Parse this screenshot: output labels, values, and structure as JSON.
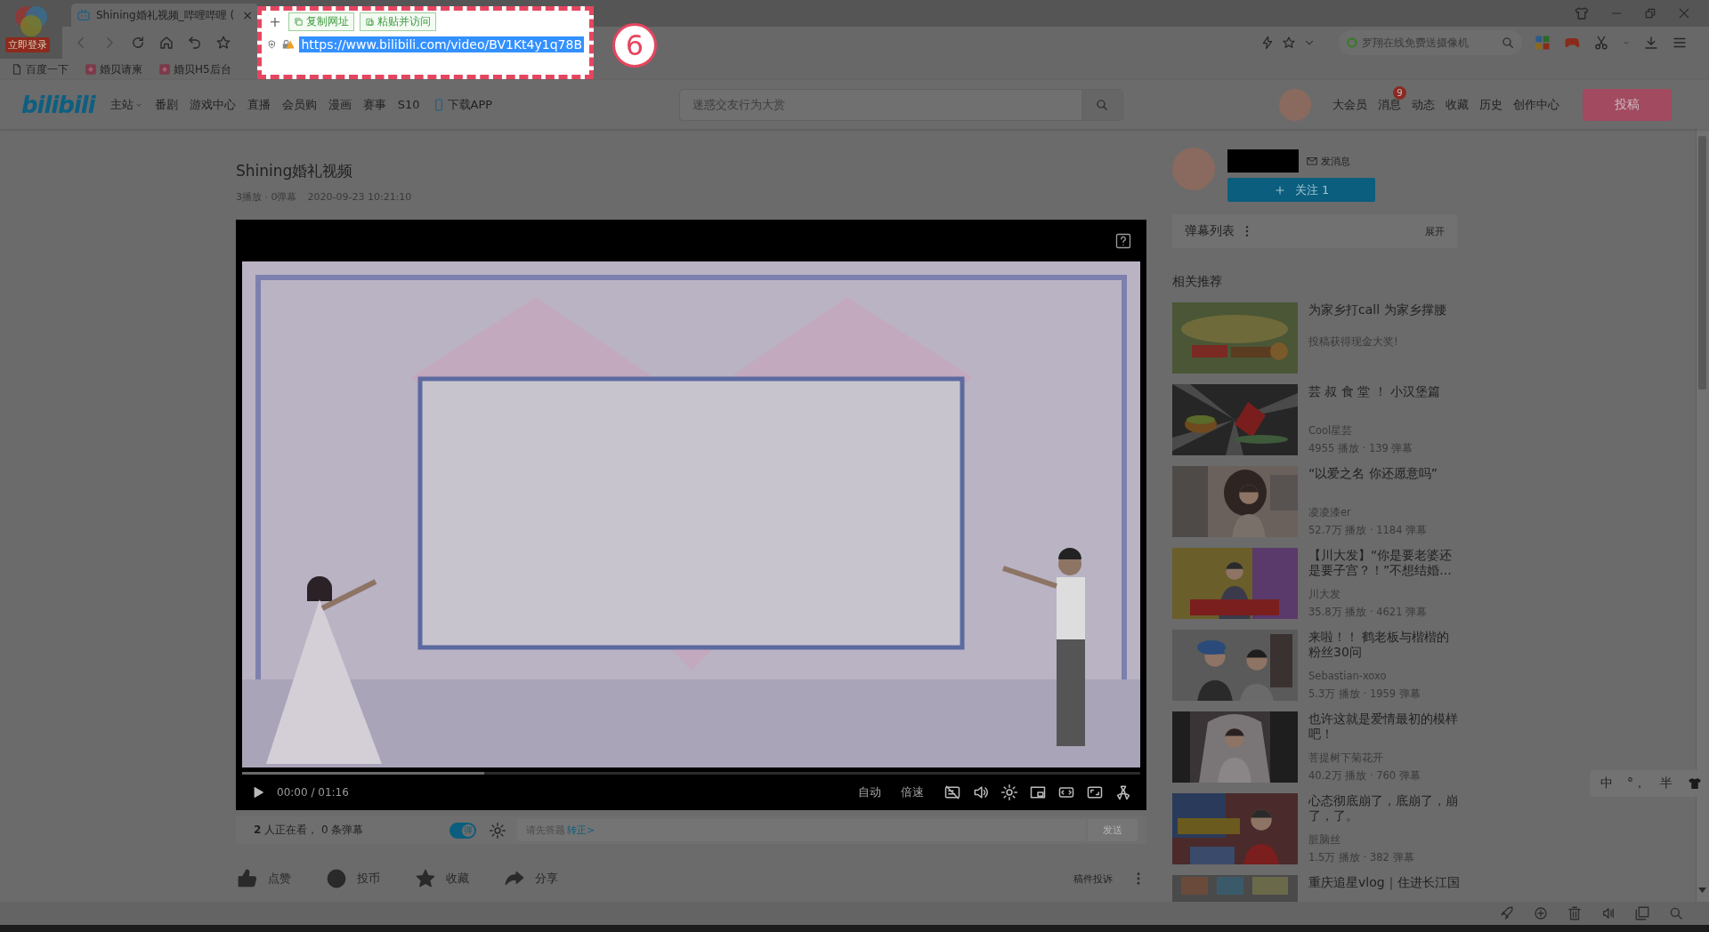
{
  "browser": {
    "login_badge": "立即登录",
    "tab": {
      "title": "Shining婚礼视频_哔哩哔哩 (",
      "close": "×"
    },
    "new_tab": "+",
    "address_popup": {
      "buttons": [
        "复制网址",
        "粘贴并访问"
      ],
      "url": "https://www.bilibili.com/video/BV1Kt4y1q78B",
      "url_selected": true
    },
    "callout": "6",
    "search": {
      "placeholder": "罗翔在线免费送摄像机"
    },
    "bookmarks": [
      {
        "kind": "page",
        "label": "百度一下"
      },
      {
        "kind": "site",
        "label": "婚贝请柬"
      },
      {
        "kind": "site",
        "label": "婚贝H5后台"
      }
    ]
  },
  "nav": {
    "logo": "bilibili",
    "items": [
      {
        "label": "主站",
        "dropdown": true
      },
      {
        "label": "番剧",
        "dropdown": false
      },
      {
        "label": "游戏中心",
        "dropdown": false
      },
      {
        "label": "直播",
        "dropdown": false
      },
      {
        "label": "会员购",
        "dropdown": false
      },
      {
        "label": "漫画",
        "dropdown": false
      },
      {
        "label": "赛事",
        "dropdown": false
      },
      {
        "label": "S10",
        "dropdown": false
      }
    ],
    "download": "下载APP",
    "search": {
      "placeholder": "迷惑交友行为大赏"
    },
    "links": [
      {
        "label": "大会员"
      },
      {
        "label": "消息",
        "badge": "9"
      },
      {
        "label": "动态"
      },
      {
        "label": "收藏"
      },
      {
        "label": "历史"
      },
      {
        "label": "创作中心"
      }
    ],
    "upload": "投稿"
  },
  "video": {
    "title": "Shining婚礼视频",
    "stats": "3播放 · 0弹幕",
    "date": "2020-09-23 10:21:10",
    "player": {
      "time": "00:00 / 01:16",
      "buffered": {
        "level": 0.27
      },
      "buttons": [
        "自动",
        "倍速"
      ]
    }
  },
  "danmaku_bar": {
    "viewers": "**2** 人正在看， 0 条弹幕",
    "toggle": {
      "label": "弹",
      "on": true
    },
    "input": {
      "placeholder": "请先答题",
      "link": "转正>"
    },
    "send": {
      "label": "发送",
      "disabled": true
    }
  },
  "actions": [
    {
      "kind": "like",
      "label": "点赞"
    },
    {
      "kind": "coin",
      "label": "投币"
    },
    {
      "kind": "favorite",
      "label": "收藏"
    },
    {
      "kind": "share",
      "label": "分享"
    }
  ],
  "report": "稿件投诉",
  "uploader": {
    "message": "发消息",
    "follow": "关注 1"
  },
  "danmaku_list": {
    "title": "弹幕列表",
    "expand": "展开"
  },
  "related": {
    "title": "相关推荐",
    "items": [
      {
        "kind": "ad",
        "title": "为家乡打call 为家乡撑腰",
        "note": "投稿获得现金大奖!"
      },
      {
        "kind": "video",
        "title": "芸 叔 食 堂 ！ 小汉堡篇",
        "author": "Cool星芸",
        "stats": "4955 播放 · 139 弹幕"
      },
      {
        "kind": "video",
        "title": "“以爱之名 你还愿意吗”",
        "author": "凌凌漆er",
        "stats": "52.7万 播放 · 1184 弹幕"
      },
      {
        "kind": "video",
        "title": "【川大发】“你是要老婆还是要子宫？！”不想结婚...",
        "author": "川大发",
        "stats": "35.8万 播放 · 4621 弹幕"
      },
      {
        "kind": "video",
        "title": "来啦！！ 鹤老板与楷楷的粉丝30问",
        "author": "Sebastian-xoxo",
        "stats": "5.3万 播放 · 1959 弹幕"
      },
      {
        "kind": "video",
        "title": "也许这就是爱情最初的模样吧！",
        "author": "菩提树下菊花开",
        "stats": "40.2万 播放 · 760 弹幕"
      },
      {
        "kind": "video",
        "title": "心态彻底崩了，底崩了，崩了，了。",
        "author": "脏脑丝",
        "stats": "1.5万 播放 · 382 弹幕"
      },
      {
        "kind": "partial",
        "title": "重庆追星vlog｜住进长江国"
      }
    ]
  },
  "ime": {
    "items": [
      "中",
      "°，",
      "半"
    ]
  }
}
